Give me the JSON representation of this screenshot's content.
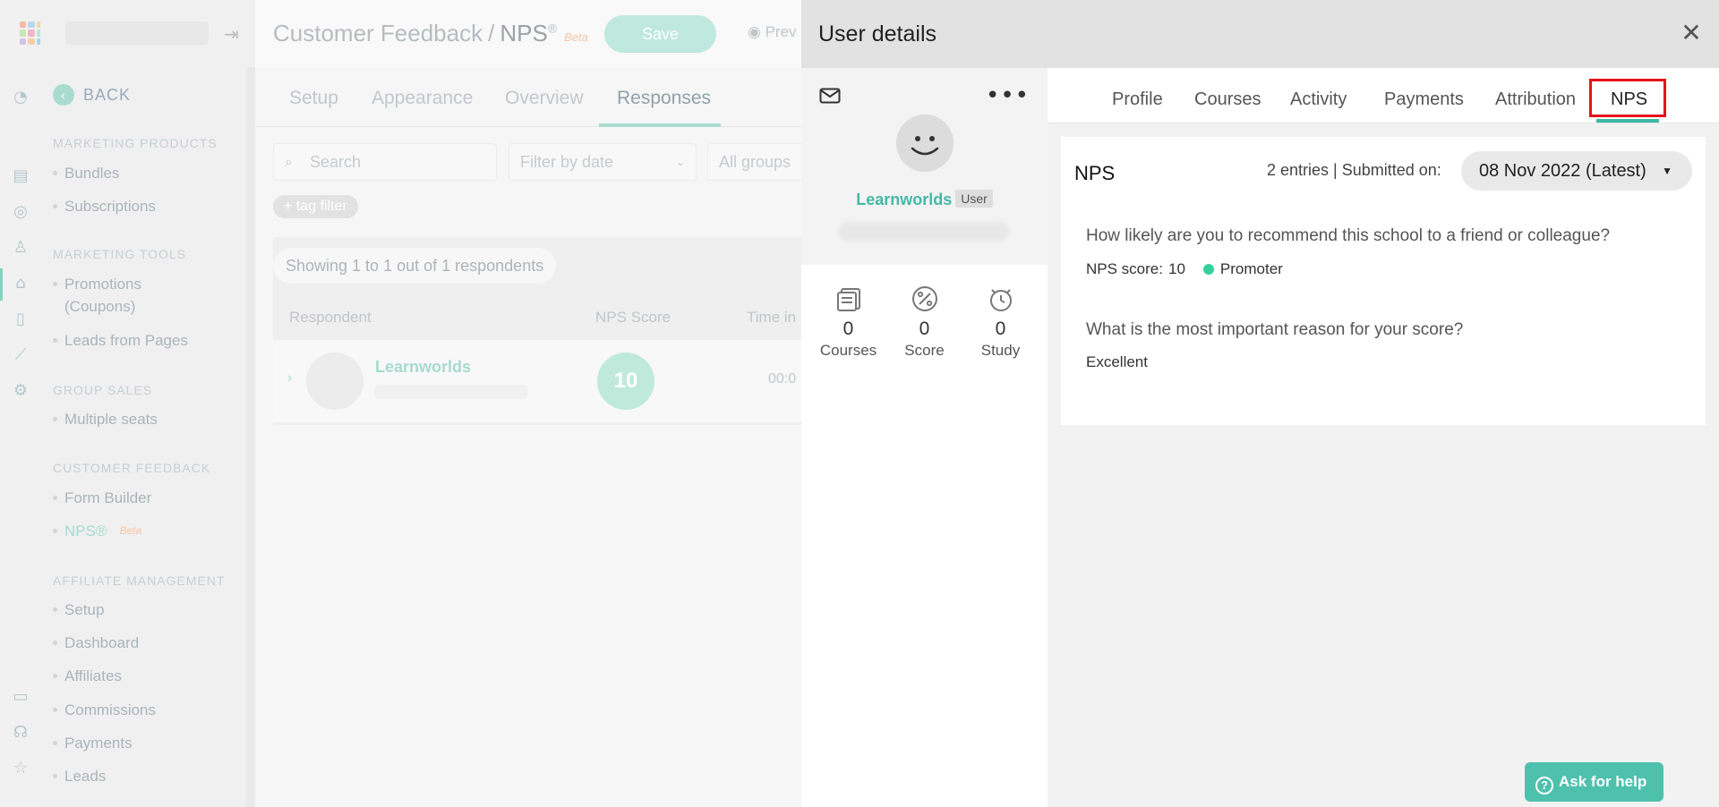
{
  "background": {
    "page_title": {
      "section": "Customer Feedback",
      "separator": "/",
      "name": "NPS",
      "superscript": "®",
      "badge": "Beta"
    },
    "save_label": "Save",
    "preview_label": "Prev",
    "tabs": [
      {
        "label": "Setup"
      },
      {
        "label": "Appearance"
      },
      {
        "label": "Overview"
      },
      {
        "label": "Responses"
      }
    ],
    "search_placeholder": "Search",
    "filter_date": "Filter by date",
    "filter_groups": "All groups",
    "tag_filter": "+ tag filter",
    "showing": "Showing 1 to 1 out of 1 respondents",
    "columns": {
      "respondent": "Respondent",
      "nps_score": "NPS Score",
      "time": "Time in p"
    },
    "row": {
      "name": "Learnworlds",
      "score": "10",
      "time": "00:0"
    },
    "sidebar": {
      "back": "BACK",
      "sections": [
        {
          "title": "MARKETING PRODUCTS",
          "items": [
            "Bundles",
            "Subscriptions"
          ]
        },
        {
          "title": "MARKETING TOOLS",
          "items": [
            "Promotions (Coupons)",
            "Leads from Pages"
          ]
        },
        {
          "title": "GROUP SALES",
          "items": [
            "Multiple seats"
          ]
        },
        {
          "title": "CUSTOMER FEEDBACK",
          "items": [
            "Form Builder",
            "NPS®"
          ]
        },
        {
          "title": "AFFILIATE MANAGEMENT",
          "items": [
            "Setup",
            "Dashboard",
            "Affiliates",
            "Commissions",
            "Payments",
            "Leads"
          ]
        }
      ],
      "nps_badge": "Beta"
    }
  },
  "drawer": {
    "title": "User details",
    "user": {
      "name": "Learnworlds",
      "role": "User"
    },
    "stats": [
      {
        "value": "0",
        "label": "Courses",
        "icon": "courses-icon"
      },
      {
        "value": "0",
        "label": "Score",
        "icon": "score-icon"
      },
      {
        "value": "0",
        "label": "Study",
        "icon": "study-icon"
      }
    ],
    "tabs": [
      {
        "label": "Profile"
      },
      {
        "label": "Courses"
      },
      {
        "label": "Activity"
      },
      {
        "label": "Payments"
      },
      {
        "label": "Attribution"
      },
      {
        "label": "NPS"
      }
    ],
    "active_tab": "NPS",
    "nps": {
      "title": "NPS",
      "meta": "2 entries | Submitted on:",
      "date_selected": "08 Nov 2022 (Latest)",
      "question1": "How likely are you to recommend this school to a friend or colleague?",
      "score_label": "NPS score:",
      "score_value": "10",
      "category": "Promoter",
      "question2": "What is the most important reason for your score?",
      "answer2": "Excellent"
    }
  },
  "help_button": "Ask for help",
  "colors": {
    "accent": "#3cb7a3",
    "highlight": "#e6131b",
    "promoter": "#33d29d"
  }
}
